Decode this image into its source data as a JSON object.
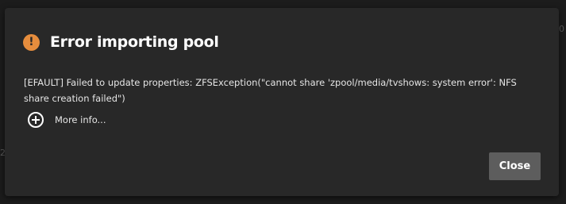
{
  "dialog": {
    "icon": "warning-circle-icon",
    "icon_glyph": "!",
    "accent_color": "#e68d3d",
    "title": "Error importing pool",
    "message": "[EFAULT] Failed to update properties: ZFSException(\"cannot share 'zpool/media/tvshows: system error': NFS share creation failed\")",
    "more_info": {
      "icon": "plus-circle-icon",
      "label": "More info..."
    },
    "close_button": {
      "label": "Close"
    }
  },
  "background": {
    "edge_right_1": "0",
    "edge_left_1": "2"
  }
}
